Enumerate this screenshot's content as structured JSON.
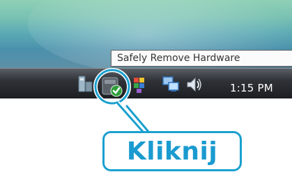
{
  "tooltip": {
    "text": "Safely Remove Hardware"
  },
  "tray": {
    "clock": "1:15 PM",
    "icons": [
      "hardware-icon",
      "safely-remove-hardware-icon",
      "color-icon",
      "network-icon",
      "volume-icon"
    ]
  },
  "callout": {
    "label": "Kliknij"
  },
  "colors": {
    "accent": "#1a9bd0"
  }
}
